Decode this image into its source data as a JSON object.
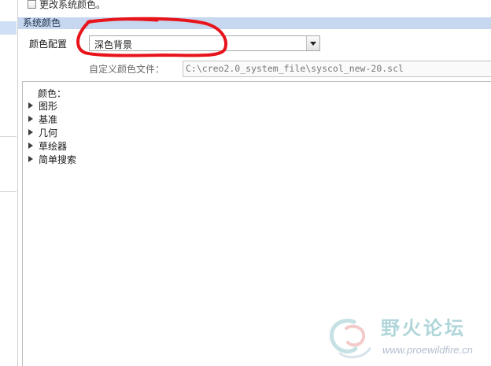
{
  "checkbox_option": {
    "label": "更改系统颜色。"
  },
  "section": {
    "title": "系统颜色"
  },
  "color_scheme": {
    "label": "颜色配置",
    "selected": "深色背景"
  },
  "custom_file": {
    "label": "自定义颜色文件：",
    "value": "C:\\creo2.0_system_file\\syscol_new-20.scl"
  },
  "tree": {
    "header": "颜色：",
    "items": [
      {
        "label": "图形"
      },
      {
        "label": "基准"
      },
      {
        "label": "几何"
      },
      {
        "label": "草绘器"
      },
      {
        "label": "简单搜索"
      }
    ]
  },
  "watermark": {
    "name": "野火论坛",
    "url": "www.proewildfire.cn"
  },
  "colors": {
    "annotation_red": "#e8141b",
    "section_header_bg": "#c6d7ef",
    "selected_nav": "#cfe0f5"
  }
}
